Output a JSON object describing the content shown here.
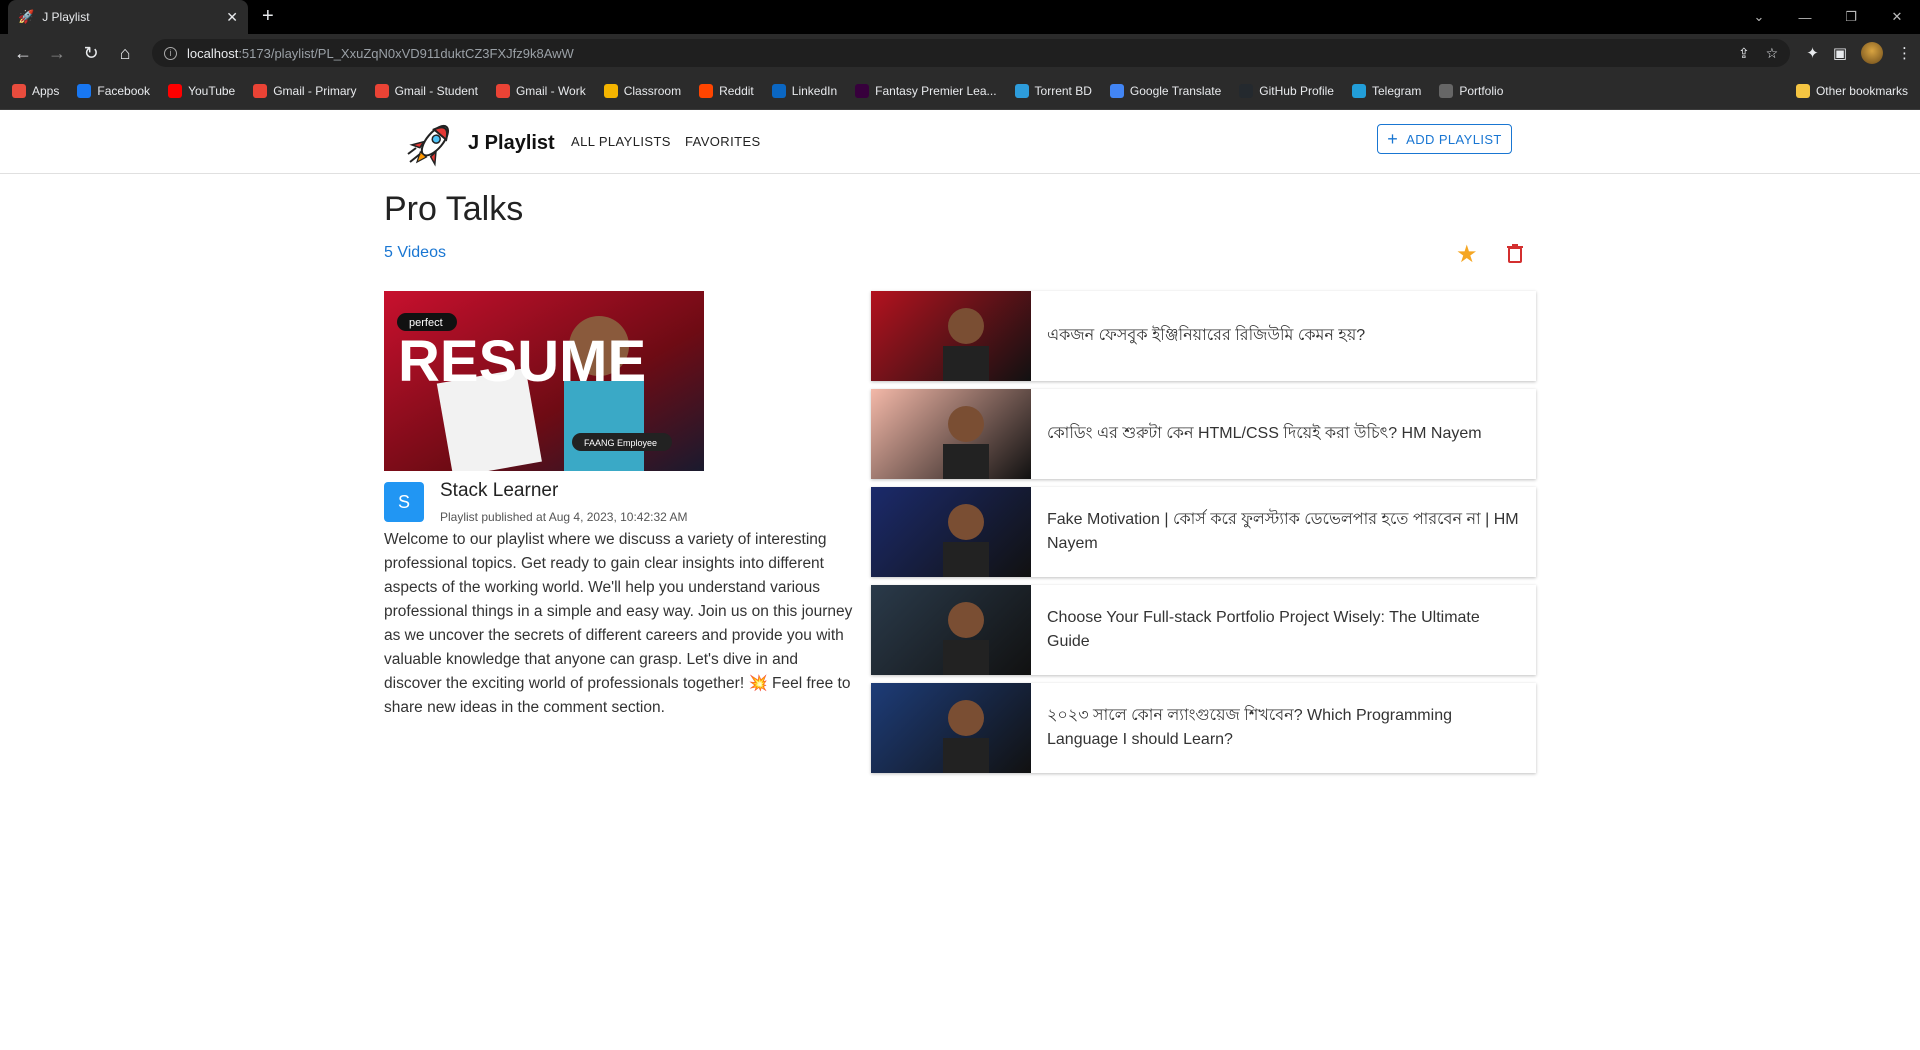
{
  "browser": {
    "tab_title": "J Playlist",
    "url_host": "localhost",
    "url_path": ":5173/playlist/PL_XxuZqN0xVD911duktCZ3FXJfz9k8AwW",
    "bookmarks": [
      {
        "label": "Apps",
        "color": "#e84c3d",
        "icon": "apps-grid-icon"
      },
      {
        "label": "Facebook",
        "color": "#1877f2",
        "icon": "facebook-icon"
      },
      {
        "label": "YouTube",
        "color": "#ff0000",
        "icon": "youtube-icon"
      },
      {
        "label": "Gmail - Primary",
        "color": "#ea4335",
        "icon": "gmail-icon"
      },
      {
        "label": "Gmail - Student",
        "color": "#ea4335",
        "icon": "gmail-icon"
      },
      {
        "label": "Gmail - Work",
        "color": "#ea4335",
        "icon": "gmail-icon"
      },
      {
        "label": "Classroom",
        "color": "#f4b400",
        "icon": "classroom-icon"
      },
      {
        "label": "Reddit",
        "color": "#ff4500",
        "icon": "reddit-icon"
      },
      {
        "label": "LinkedIn",
        "color": "#0a66c2",
        "icon": "linkedin-icon"
      },
      {
        "label": "Fantasy Premier Lea...",
        "color": "#37003c",
        "icon": "fpl-icon"
      },
      {
        "label": "Torrent BD",
        "color": "#2d9cdb",
        "icon": "torrent-icon"
      },
      {
        "label": "Google Translate",
        "color": "#4285f4",
        "icon": "translate-icon"
      },
      {
        "label": "GitHub Profile",
        "color": "#24292e",
        "icon": "github-icon"
      },
      {
        "label": "Telegram",
        "color": "#229ed9",
        "icon": "telegram-icon"
      },
      {
        "label": "Portfolio",
        "color": "#666666",
        "icon": "portfolio-icon"
      }
    ],
    "other_bookmarks": "Other bookmarks"
  },
  "header": {
    "brand": "J Playlist",
    "nav_all": "ALL PLAYLISTS",
    "nav_fav": "FAVORITES",
    "add_playlist": "ADD PLAYLIST",
    "add_icon": "+"
  },
  "playlist": {
    "title": "Pro Talks",
    "video_count": "5 Videos",
    "channel_initial": "S",
    "channel_name": "Stack Learner",
    "published": "Playlist published at Aug 4, 2023, 10:42:32 AM",
    "description": "Welcome to our playlist where we discuss a variety of interesting professional topics. Get ready to gain clear insights into different aspects of the working world. We'll help you understand various professional things in a simple and easy way. Join us on this journey as we uncover the secrets of different careers and provide you with valuable knowledge that anyone can grasp. Let's dive in and discover the exciting world of professionals together! 💥 Feel free to share new ideas in the comment section.",
    "thumb_text": "RESUME",
    "thumb_badge": "perfect",
    "thumb_tag": "FAANG Employee"
  },
  "videos": [
    {
      "title": "একজন ফেসবুক ইঞ্জিনিয়ারের রিজিউমি কেমন হয়?",
      "bg": "#b3121f"
    },
    {
      "title": "কোডিং এর শুরুটা কেন HTML/CSS দিয়েই করা উচিৎ? HM Nayem",
      "bg": "#f3b8a8"
    },
    {
      "title": "Fake Motivation | কোর্স করে ফুলস্ট্যাক ডেভেলপার হতে পারবেন না | HM Nayem",
      "bg": "#1b2a6b"
    },
    {
      "title": "Choose Your Full-stack Portfolio Project Wisely: The Ultimate Guide",
      "bg": "#2a3a4a"
    },
    {
      "title": "২০২৩ সালে কোন ল্যাংগুয়েজ শিখবেন? Which Programming Language I should Learn?",
      "bg": "#1d3c78"
    }
  ]
}
